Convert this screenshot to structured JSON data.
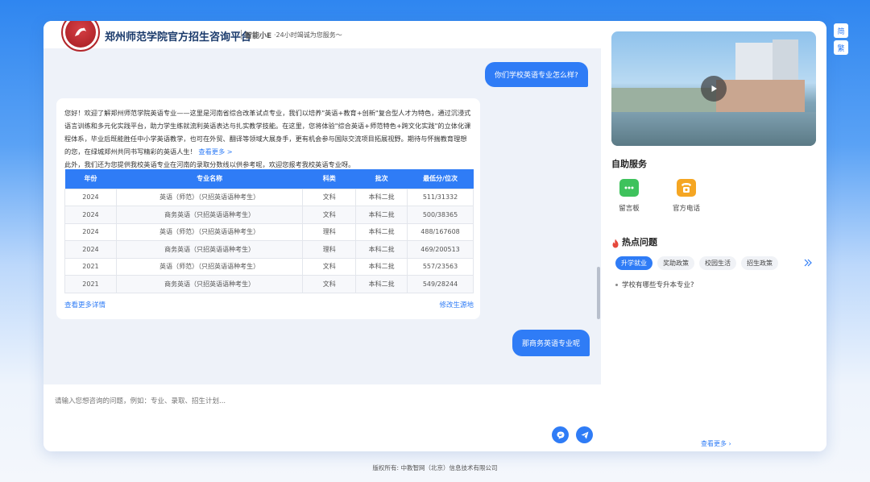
{
  "header": {
    "title": "郑州师范学院官方招生咨询平台",
    "ai_name": "智能小E",
    "tagline": "·24小时竭诚为您服务～"
  },
  "chat": {
    "q1": "你们学校英语专业怎么样?",
    "answer_intro": "您好！欢迎了解郑州师范学院英语专业——这里是河南省综合改革试点专业，我们以培养\"英语+教育+创新\"复合型人才为特色，通过沉浸式语言训练和多元化实践平台，助力学生练就流利英语表达与扎实教学技能。在这里，您将体验\"综合英语+师范特色+跨文化实践\"的立体化课程体系，毕业后既能胜任中小学英语教学，也可在外贸、翻译等领域大展身手，更有机会参与国际交流项目拓展视野。期待与怀揣教育理想的您，在绿城郑州共同书写精彩的英语人生！",
    "answer_more": "查看更多 >",
    "answer_outro": "此外，我们还为您提供我校英语专业在河南的录取分数线以供参考呢，欢迎您报考我校英语专业呀。",
    "table": {
      "headers": [
        "年份",
        "专业名称",
        "科类",
        "批次",
        "最低分/位次"
      ],
      "rows": [
        [
          "2024",
          "英语（师范）（只招英语语种考生）",
          "文科",
          "本科二批",
          "511/31332"
        ],
        [
          "2024",
          "商务英语（只招英语语种考生）",
          "文科",
          "本科二批",
          "500/38365"
        ],
        [
          "2024",
          "英语（师范）（只招英语语种考生）",
          "理科",
          "本科二批",
          "488/167608"
        ],
        [
          "2024",
          "商务英语（只招英语语种考生）",
          "理科",
          "本科二批",
          "469/200513"
        ],
        [
          "2021",
          "英语（师范）（只招英语语种考生）",
          "文科",
          "本科二批",
          "557/23563"
        ],
        [
          "2021",
          "商务英语（只招英语语种考生）",
          "文科",
          "本科二批",
          "549/28244"
        ]
      ]
    },
    "link_details": "查看更多详情",
    "link_region": "修改生源地",
    "q2": "那商务英语专业呢"
  },
  "input": {
    "placeholder": "请输入您想咨询的问题，例如：专业、录取、招生计划..."
  },
  "sidebar": {
    "self_service_title": "自助服务",
    "services": [
      {
        "label": "留言板",
        "icon": "message-board-icon",
        "color": "#3ec25c"
      },
      {
        "label": "官方电话",
        "icon": "phone-icon",
        "color": "#f5a623"
      }
    ],
    "hot_title": "热点问题",
    "chips": [
      "升学就业",
      "奖助政策",
      "校园生活",
      "招生政策"
    ],
    "question": "学校有哪些专升本专业?",
    "see_more": "查看更多"
  },
  "lang": {
    "simplified": "简",
    "traditional": "繁"
  },
  "footer": "版权所有: 中教智网（北京）信息技术有限公司",
  "colors": {
    "accent": "#2f7cf6",
    "brand_red": "#b3262b"
  }
}
